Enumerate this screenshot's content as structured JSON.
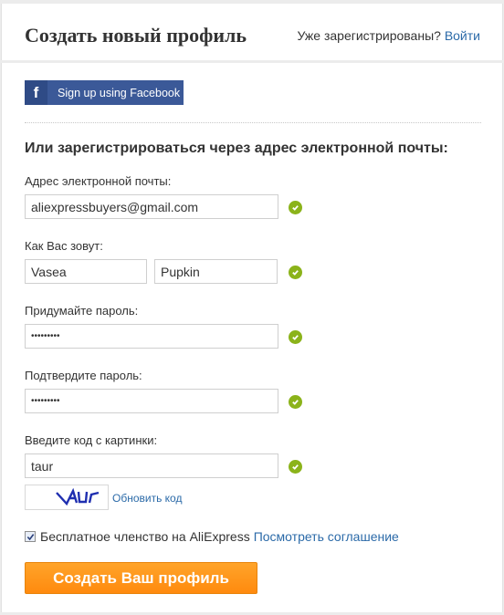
{
  "header": {
    "title": "Создать новый профиль",
    "already_registered": "Уже зарегистрированы?",
    "login_link": "Войти"
  },
  "facebook": {
    "icon": "facebook-f-icon",
    "label": "Sign up using Facebook"
  },
  "form": {
    "subheading": "Или зарегистрироваться через адрес электронной почты:",
    "email": {
      "label": "Адрес электронной почты:",
      "value": "aliexpressbuyers@gmail.com",
      "valid": true
    },
    "name": {
      "label": "Как Вас зовут:",
      "first_name": "Vasea",
      "last_name": "Pupkin",
      "valid": true
    },
    "password": {
      "label": "Придумайте пароль:",
      "value": "•••••••••",
      "valid": true
    },
    "confirm_password": {
      "label": "Подтвердите пароль:",
      "value": "•••••••••",
      "valid": true
    },
    "captcha": {
      "label": "Введите код с картинки:",
      "value": "taur",
      "image_text": "tAUr",
      "refresh_link": "Обновить код",
      "valid": true
    },
    "agreement": {
      "checked": true,
      "text": "Бесплатное членство на AliExpress",
      "link": "Посмотреть соглашение"
    },
    "submit_label": "Создать Ваш профиль"
  },
  "colors": {
    "accent_link": "#2b6aa8",
    "valid_green": "#8bb31a",
    "facebook_blue": "#3b5998",
    "submit_orange": "#ff9619"
  }
}
